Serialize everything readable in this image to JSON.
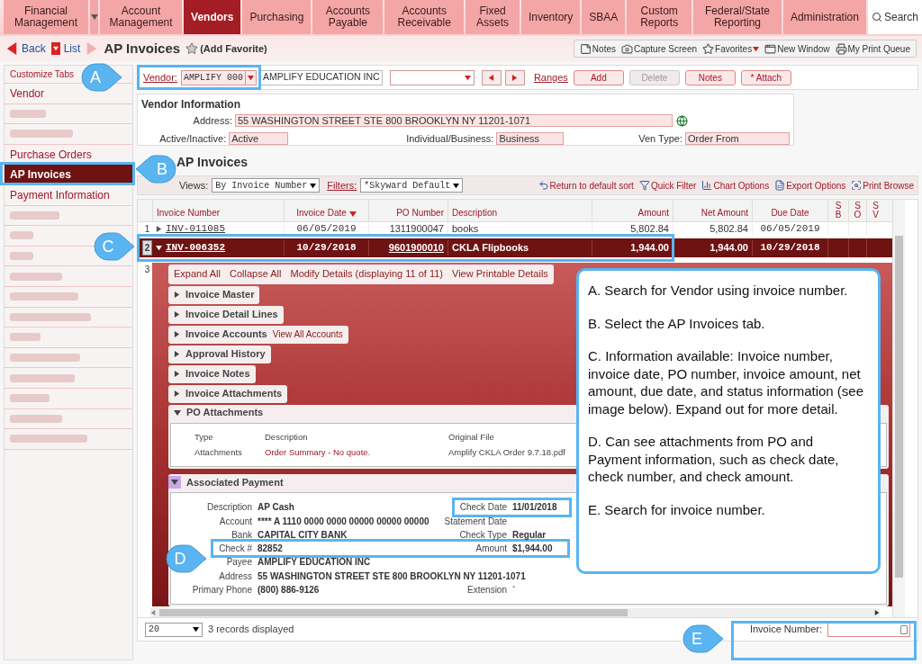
{
  "nav": {
    "items": [
      {
        "label": "Financial Management",
        "selected": false,
        "dropdown": true
      },
      {
        "label": "Account Management",
        "selected": false,
        "dropdown": false
      },
      {
        "label": "Vendors",
        "selected": true,
        "dropdown": false
      },
      {
        "label": "Purchasing",
        "selected": false,
        "dropdown": false
      },
      {
        "label": "Accounts Payable",
        "selected": false,
        "dropdown": false
      },
      {
        "label": "Accounts Receivable",
        "selected": false,
        "dropdown": false
      },
      {
        "label": "Fixed Assets",
        "selected": false,
        "dropdown": false
      },
      {
        "label": "Inventory",
        "selected": false,
        "dropdown": false
      },
      {
        "label": "SBAA",
        "selected": false,
        "dropdown": false
      },
      {
        "label": "Custom Reports",
        "selected": false,
        "dropdown": false
      },
      {
        "label": "Federal/State Reporting",
        "selected": false,
        "dropdown": false
      },
      {
        "label": "Administration",
        "selected": false,
        "dropdown": false
      }
    ],
    "search": "Search"
  },
  "header": {
    "back": "Back",
    "list": "List",
    "title": "AP Invoices",
    "favorite": "(Add Favorite)"
  },
  "toolbar": [
    {
      "label": "Notes",
      "kind": "notes",
      "dropdown": false
    },
    {
      "label": "Capture Screen",
      "kind": "camera",
      "dropdown": false
    },
    {
      "label": "Favorites",
      "kind": "star",
      "dropdown": true
    },
    {
      "label": "New Window",
      "kind": "window",
      "dropdown": false
    },
    {
      "label": "My Print Queue",
      "kind": "printer",
      "dropdown": false
    }
  ],
  "sidebar": {
    "customize": "Customize Tabs",
    "items": [
      {
        "label": "Vendor",
        "kind": "link",
        "selected": false
      },
      {
        "kind": "blurred"
      },
      {
        "kind": "blurred"
      },
      {
        "label": "Purchase Orders",
        "kind": "link",
        "selected": false
      },
      {
        "label": "AP Invoices",
        "kind": "link",
        "selected": true
      },
      {
        "label": "Payment Information",
        "kind": "link",
        "selected": false
      },
      {
        "kind": "blurred"
      },
      {
        "kind": "blurred"
      },
      {
        "kind": "blurred"
      },
      {
        "kind": "blurred"
      },
      {
        "kind": "blurred"
      },
      {
        "kind": "blurred"
      },
      {
        "kind": "blurred"
      },
      {
        "kind": "blurred"
      },
      {
        "kind": "blurred"
      },
      {
        "kind": "blurred"
      },
      {
        "kind": "blurred"
      },
      {
        "kind": "blurred"
      }
    ]
  },
  "vendor_bar": {
    "label": "Vendor:",
    "code": "AMPLIFY 000",
    "name": "AMPLIFY EDUCATION INC",
    "ranges": "Ranges",
    "buttons": [
      {
        "label": "Add",
        "disabled": false
      },
      {
        "label": "Delete",
        "disabled": true
      },
      {
        "label": "Notes",
        "disabled": false
      },
      {
        "label": "* Attach",
        "disabled": false
      }
    ]
  },
  "vendor_info": {
    "title": "Vendor Information",
    "address_label": "Address:",
    "address": "55 WASHINGTON STREET STE 800 BROOKLYN NY 11201-1071",
    "fields": [
      {
        "label": "Active/Inactive:",
        "value": "Active"
      },
      {
        "label": "Individual/Business:",
        "value": "Business"
      },
      {
        "label": "Ven Type:",
        "value": "Order From"
      }
    ]
  },
  "section_title": "AP Invoices",
  "views": {
    "label": "Views:",
    "value": "By Invoice Number",
    "filters_label": "Filters:",
    "filter": "*Skyward Default",
    "actions": [
      {
        "label": "Return to default sort",
        "kind": "undo"
      },
      {
        "label": "Quick Filter",
        "kind": "filter"
      },
      {
        "label": "Chart Options",
        "kind": "chart"
      },
      {
        "label": "Export Options",
        "kind": "export"
      },
      {
        "label": "Print Browse",
        "kind": "print"
      }
    ]
  },
  "table": {
    "columns": [
      {
        "label": "Invoice Number",
        "sorted": false
      },
      {
        "label": "Invoice Date",
        "sorted": true
      },
      {
        "label": "PO Number",
        "sorted": false
      },
      {
        "label": "Description",
        "sorted": false
      },
      {
        "label": "Amount",
        "sorted": false
      },
      {
        "label": "Net Amount",
        "sorted": false
      },
      {
        "label": "Due Date",
        "sorted": false
      },
      {
        "label": "S B",
        "sorted": false
      },
      {
        "label": "S O",
        "sorted": false
      },
      {
        "label": "S V",
        "sorted": false
      }
    ],
    "rows": [
      {
        "num": "1",
        "selected": false,
        "expanded": false,
        "cells": [
          "INV-011085",
          "06/05/2019",
          "1311900047",
          "books",
          "5,802.84",
          "5,802.84",
          "06/05/2019"
        ]
      },
      {
        "num": "2",
        "selected": true,
        "expanded": true,
        "cells": [
          "INV-006352",
          "10/29/2018",
          "9601900010",
          "CKLA Flipbooks",
          "1,944.00",
          "1,944.00",
          "10/29/2018"
        ]
      },
      {
        "num": "3",
        "selected": false
      }
    ]
  },
  "detail": {
    "links": [
      "Expand All",
      "Collapse All",
      "Modify Details (displaying 11 of 11)",
      "View Printable Details"
    ],
    "sections": [
      {
        "title": "Invoice Master",
        "expanded": false
      },
      {
        "title": "Invoice Detail Lines",
        "expanded": false
      },
      {
        "title": "Invoice Accounts",
        "expanded": false,
        "link": "View All Accounts"
      },
      {
        "title": "Approval History",
        "expanded": false
      },
      {
        "title": "Invoice Notes",
        "expanded": false
      },
      {
        "title": "Invoice Attachments",
        "expanded": false
      }
    ],
    "po_attachments": {
      "title": "PO Attachments",
      "expanded": true,
      "columns": [
        "Type",
        "Description",
        "Original File"
      ],
      "row": [
        "Attachments",
        "Order Summary - No quote.",
        "Amplify CKLA Order 9.7.18.pdf"
      ]
    },
    "payment": {
      "title": "Associated Payment",
      "expanded": true,
      "rows": [
        {
          "label": "Description",
          "value": "AP Cash",
          "right_label": "Check Date",
          "right_value": "11/01/2018"
        },
        {
          "label": "Account",
          "value": "**** A 1110 0000 0000 00000 00000 00000",
          "right_label": "Statement Date"
        },
        {
          "label": "Bank",
          "value": "CAPITAL CITY BANK",
          "right_label": "Check Type",
          "right_value": "Regular"
        },
        {
          "label": "Check #",
          "value": "82852",
          "right_label": "Amount",
          "right_value": "$1,944.00"
        },
        {
          "label": "Payee",
          "value": "AMPLIFY EDUCATION INC"
        },
        {
          "label": "Address",
          "value": "55 WASHINGTON STREET STE 800 BROOKLYN NY 11201-1071"
        },
        {
          "label": "Primary Phone",
          "value": "(800) 886-9126",
          "right_label": "Extension",
          "right_value": "`"
        }
      ]
    }
  },
  "footer": {
    "page_size": "20",
    "records": "3 records displayed",
    "search_label": "Invoice Number:"
  },
  "callouts": [
    "A",
    "B",
    "C",
    "D",
    "E"
  ],
  "note": [
    "A. Search for Vendor using invoice number.",
    "B. Select the AP Invoices tab.",
    "C. Information available: Invoice number, invoice date, PO number, invoice amount, net amount, due date, and status information (see image below). Expand out for more detail.",
    "D. Can see attachments from PO and Payment information, such as check date, check number, and check amount.",
    "E. Search for invoice number."
  ]
}
